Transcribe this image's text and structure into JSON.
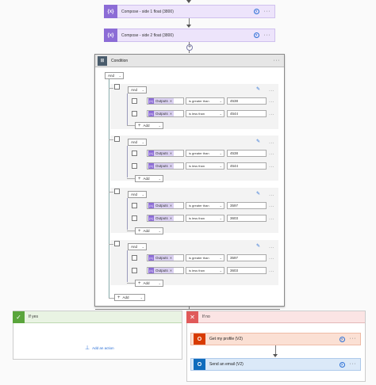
{
  "compose1": {
    "title": "Compose - side 1 float (3800)",
    "icon": "{x}"
  },
  "compose2": {
    "title": "Compose - side 2 float (3800)",
    "icon": "{x}"
  },
  "condition": {
    "title": "Condition",
    "top_operator": "And",
    "add_label": "Add",
    "groups": [
      {
        "operator": "And",
        "rows": [
          {
            "token": "Outputs",
            "op": "is greater than",
            "value": "4538"
          },
          {
            "token": "Outputs",
            "op": "is less than",
            "value": "4544"
          }
        ],
        "add_label": "Add"
      },
      {
        "operator": "And",
        "rows": [
          {
            "token": "Outputs",
            "op": "is greater than",
            "value": "4538"
          },
          {
            "token": "Outputs",
            "op": "is less than",
            "value": "4544"
          }
        ],
        "add_label": "Add"
      },
      {
        "operator": "And",
        "rows": [
          {
            "token": "Outputs",
            "op": "is greater than",
            "value": "3597"
          },
          {
            "token": "Outputs",
            "op": "is less than",
            "value": "3603"
          }
        ],
        "add_label": "Add"
      },
      {
        "operator": "And",
        "rows": [
          {
            "token": "Outputs",
            "op": "is greater than",
            "value": "3597"
          },
          {
            "token": "Outputs",
            "op": "is less than",
            "value": "3603"
          }
        ],
        "add_label": "Add"
      }
    ]
  },
  "if_yes": {
    "title": "If yes",
    "add_action": "Add an action"
  },
  "if_no": {
    "title": "If no",
    "actions": [
      {
        "title": "Get my profile (V2)",
        "color": "#d83b01"
      },
      {
        "title": "Send an email (V2)",
        "color": "#0f6cbd"
      }
    ]
  },
  "colors": {
    "compose": "#8c6cd6",
    "yes": "#5aa53c",
    "no": "#e05a5a"
  }
}
